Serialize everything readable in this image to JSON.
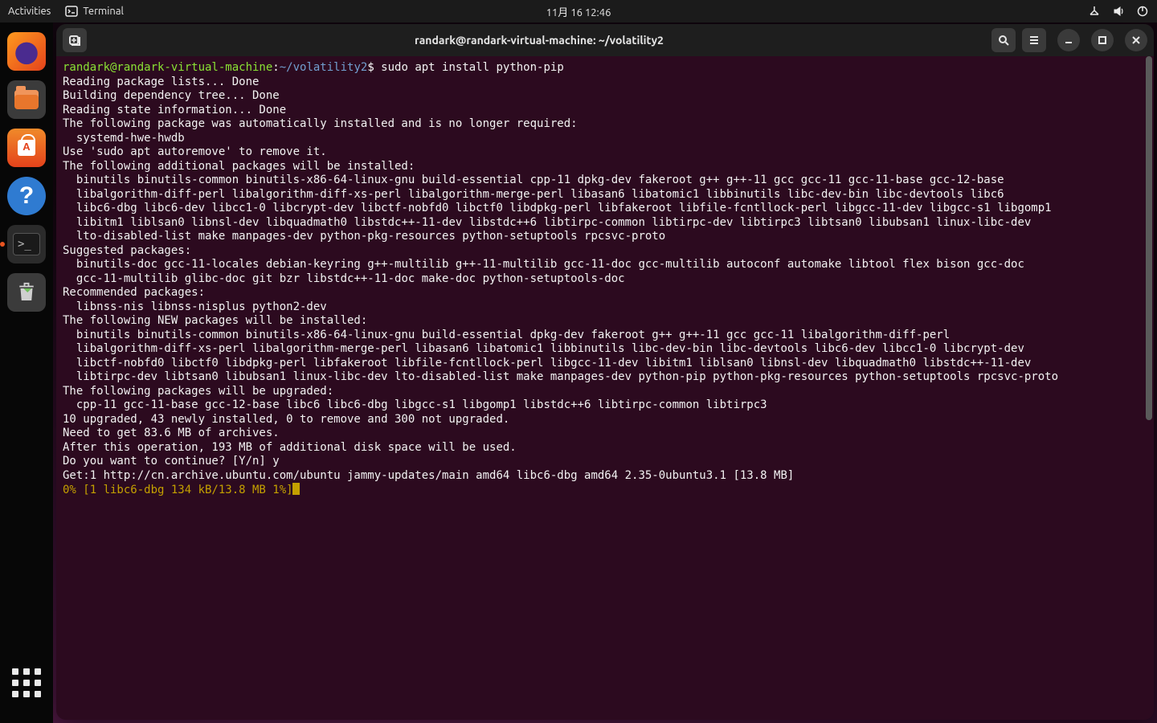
{
  "topbar": {
    "activities": "Activities",
    "app_label": "Terminal",
    "clock": "11月 16  12:46"
  },
  "window": {
    "title": "randark@randark-virtual-machine: ~/volatility2"
  },
  "prompt": {
    "userhost": "randark@randark-virtual-machine",
    "sep": ":",
    "path": "~/volatility2",
    "dollar": "$ ",
    "command": "sudo apt install python-pip"
  },
  "apt_lines": [
    "Reading package lists... Done",
    "Building dependency tree... Done",
    "Reading state information... Done",
    "The following package was automatically installed and is no longer required:",
    "  systemd-hwe-hwdb",
    "Use 'sudo apt autoremove' to remove it.",
    "The following additional packages will be installed:",
    "  binutils binutils-common binutils-x86-64-linux-gnu build-essential cpp-11 dpkg-dev fakeroot g++ g++-11 gcc gcc-11 gcc-11-base gcc-12-base",
    "  libalgorithm-diff-perl libalgorithm-diff-xs-perl libalgorithm-merge-perl libasan6 libatomic1 libbinutils libc-dev-bin libc-devtools libc6",
    "  libc6-dbg libc6-dev libcc1-0 libcrypt-dev libctf-nobfd0 libctf0 libdpkg-perl libfakeroot libfile-fcntllock-perl libgcc-11-dev libgcc-s1 libgomp1",
    "  libitm1 liblsan0 libnsl-dev libquadmath0 libstdc++-11-dev libstdc++6 libtirpc-common libtirpc-dev libtirpc3 libtsan0 libubsan1 linux-libc-dev",
    "  lto-disabled-list make manpages-dev python-pkg-resources python-setuptools rpcsvc-proto",
    "Suggested packages:",
    "  binutils-doc gcc-11-locales debian-keyring g++-multilib g++-11-multilib gcc-11-doc gcc-multilib autoconf automake libtool flex bison gcc-doc",
    "  gcc-11-multilib glibc-doc git bzr libstdc++-11-doc make-doc python-setuptools-doc",
    "Recommended packages:",
    "  libnss-nis libnss-nisplus python2-dev",
    "The following NEW packages will be installed:",
    "  binutils binutils-common binutils-x86-64-linux-gnu build-essential dpkg-dev fakeroot g++ g++-11 gcc gcc-11 libalgorithm-diff-perl",
    "  libalgorithm-diff-xs-perl libalgorithm-merge-perl libasan6 libatomic1 libbinutils libc-dev-bin libc-devtools libc6-dev libcc1-0 libcrypt-dev",
    "  libctf-nobfd0 libctf0 libdpkg-perl libfakeroot libfile-fcntllock-perl libgcc-11-dev libitm1 liblsan0 libnsl-dev libquadmath0 libstdc++-11-dev",
    "  libtirpc-dev libtsan0 libubsan1 linux-libc-dev lto-disabled-list make manpages-dev python-pip python-pkg-resources python-setuptools rpcsvc-proto",
    "The following packages will be upgraded:",
    "  cpp-11 gcc-11-base gcc-12-base libc6 libc6-dbg libgcc-s1 libgomp1 libstdc++6 libtirpc-common libtirpc3",
    "10 upgraded, 43 newly installed, 0 to remove and 300 not upgraded.",
    "Need to get 83.6 MB of archives.",
    "After this operation, 193 MB of additional disk space will be used.",
    "Do you want to continue? [Y/n] y",
    "Get:1 http://cn.archive.ubuntu.com/ubuntu jammy-updates/main amd64 libc6-dbg amd64 2.35-0ubuntu3.1 [13.8 MB]"
  ],
  "progress_line": "0% [1 libc6-dbg 134 kB/13.8 MB 1%]"
}
